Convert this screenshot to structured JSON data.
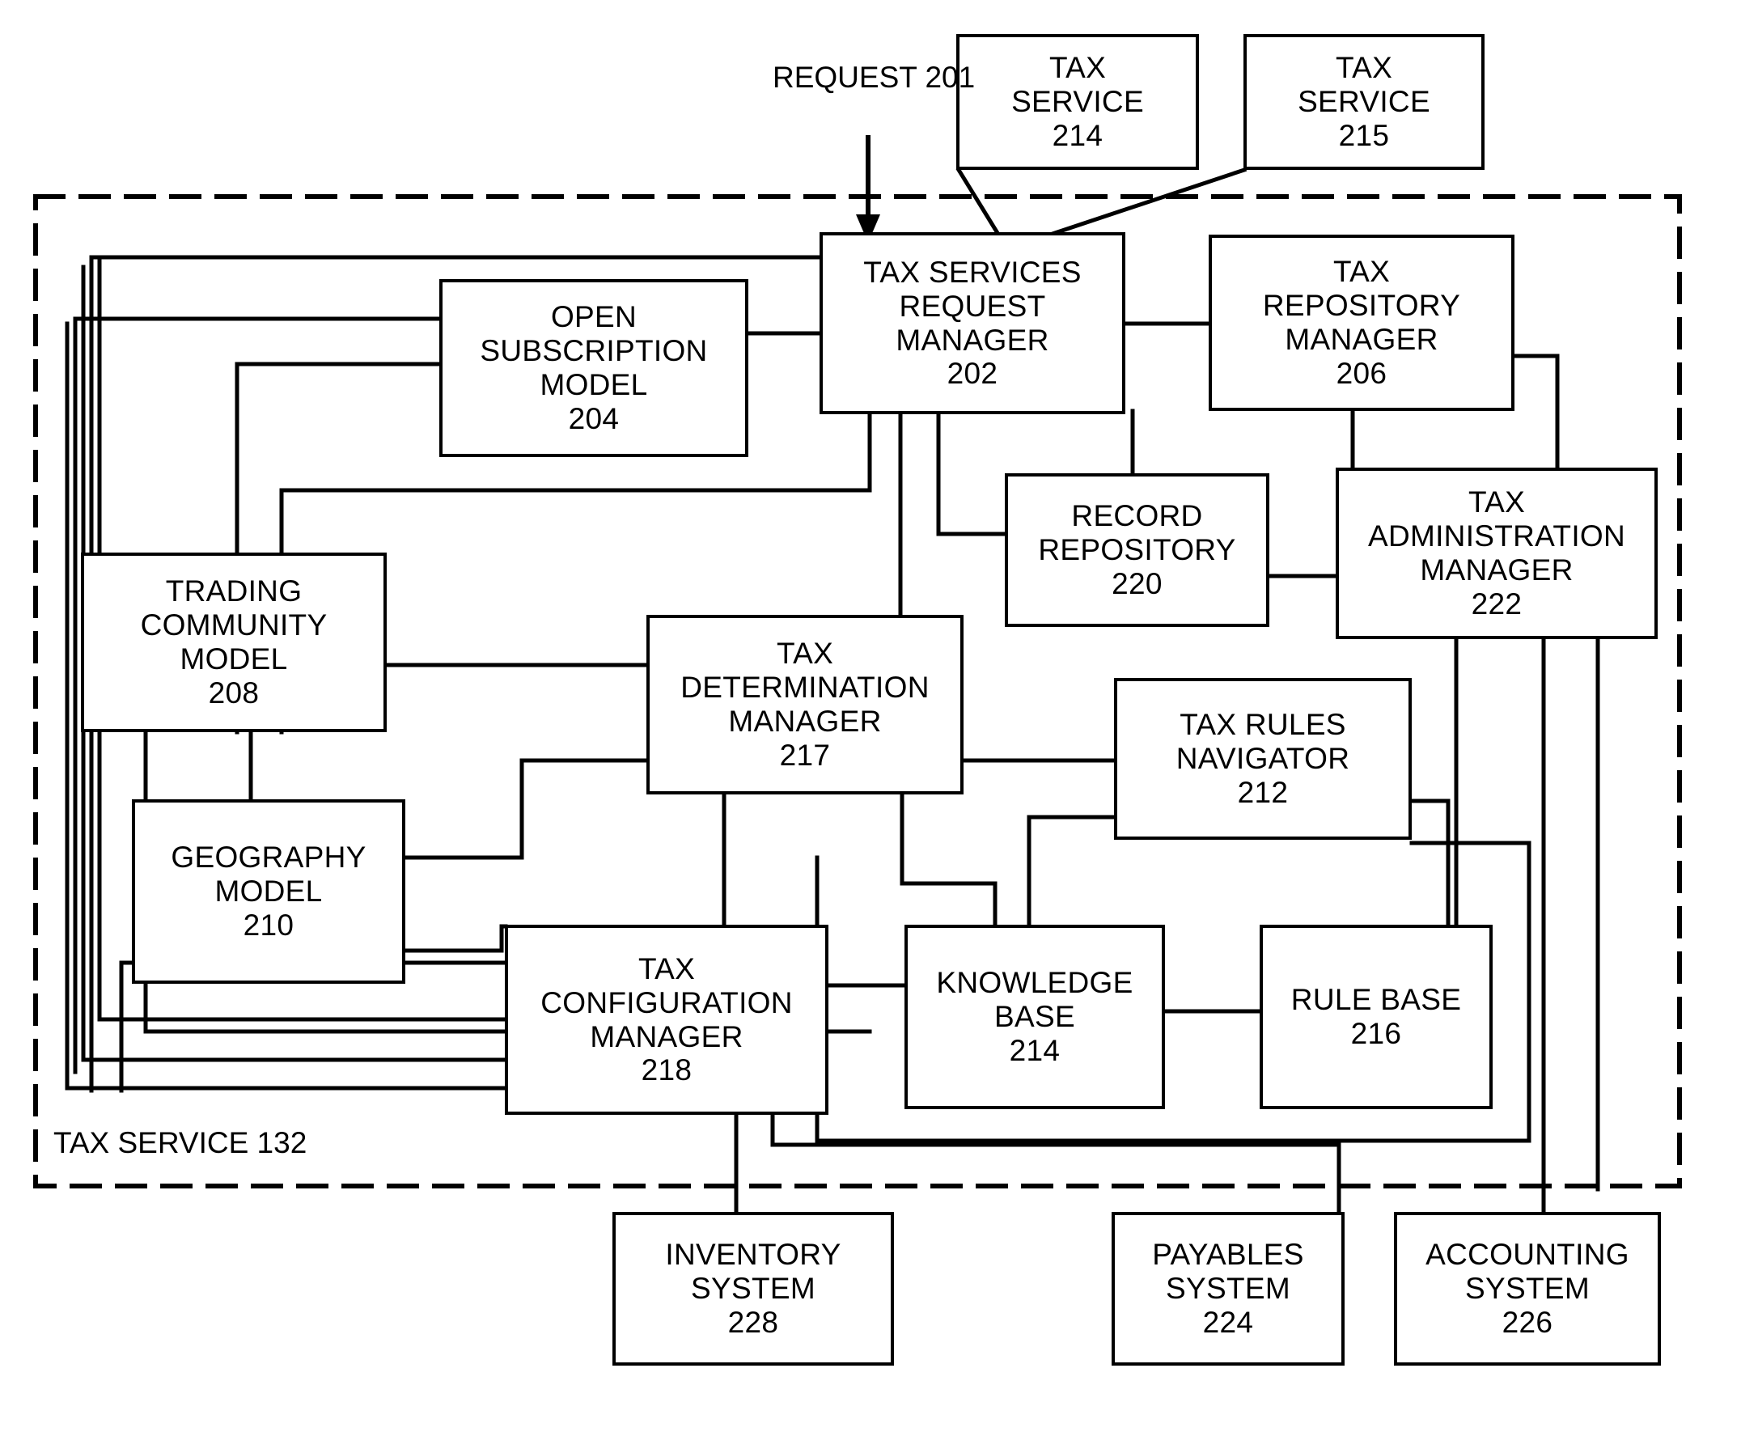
{
  "figure": {
    "kind": "patent-block-diagram",
    "boundary_label": "TAX SERVICE  132",
    "request_label_line1": "REQUEST",
    "request_label_line2": "201"
  },
  "nodes": {
    "tax_service_214_top": {
      "l1": "TAX",
      "l2": "SERVICE",
      "l3": "214"
    },
    "tax_service_215_top": {
      "l1": "TAX",
      "l2": "SERVICE",
      "l3": "215"
    },
    "tax_services_request_manager": {
      "l1": "TAX SERVICES",
      "l2": "REQUEST",
      "l3": "MANAGER",
      "l4": "202"
    },
    "open_subscription_model": {
      "l1": "OPEN",
      "l2": "SUBSCRIPTION",
      "l3": "MODEL",
      "l4": "204"
    },
    "tax_repository_manager": {
      "l1": "TAX",
      "l2": "REPOSITORY",
      "l3": "MANAGER",
      "l4": "206"
    },
    "record_repository": {
      "l1": "RECORD",
      "l2": "REPOSITORY",
      "l3": "220"
    },
    "tax_administration_manager": {
      "l1": "TAX",
      "l2": "ADMINISTRATION",
      "l3": "MANAGER",
      "l4": "222"
    },
    "trading_community_model": {
      "l1": "TRADING",
      "l2": "COMMUNITY",
      "l3": "MODEL",
      "l4": "208"
    },
    "tax_determination_manager": {
      "l1": "TAX",
      "l2": "DETERMINATION",
      "l3": "MANAGER",
      "l4": "217"
    },
    "tax_rules_navigator": {
      "l1": "TAX RULES",
      "l2": "NAVIGATOR",
      "l3": "212"
    },
    "geography_model": {
      "l1": "GEOGRAPHY",
      "l2": "MODEL",
      "l3": "210"
    },
    "tax_configuration_manager": {
      "l1": "TAX",
      "l2": "CONFIGURATION",
      "l3": "MANAGER",
      "l4": "218"
    },
    "knowledge_base": {
      "l1": "KNOWLEDGE",
      "l2": "BASE",
      "l3": "214"
    },
    "rule_base": {
      "l1": "RULE BASE",
      "l2": "216"
    },
    "inventory_system": {
      "l1": "INVENTORY",
      "l2": "SYSTEM",
      "l3": "228"
    },
    "payables_system": {
      "l1": "PAYABLES",
      "l2": "SYSTEM",
      "l3": "224"
    },
    "accounting_system": {
      "l1": "ACCOUNTING",
      "l2": "SYSTEM",
      "l3": "226"
    }
  },
  "colors": {
    "stroke": "#000000",
    "background": "#ffffff"
  }
}
